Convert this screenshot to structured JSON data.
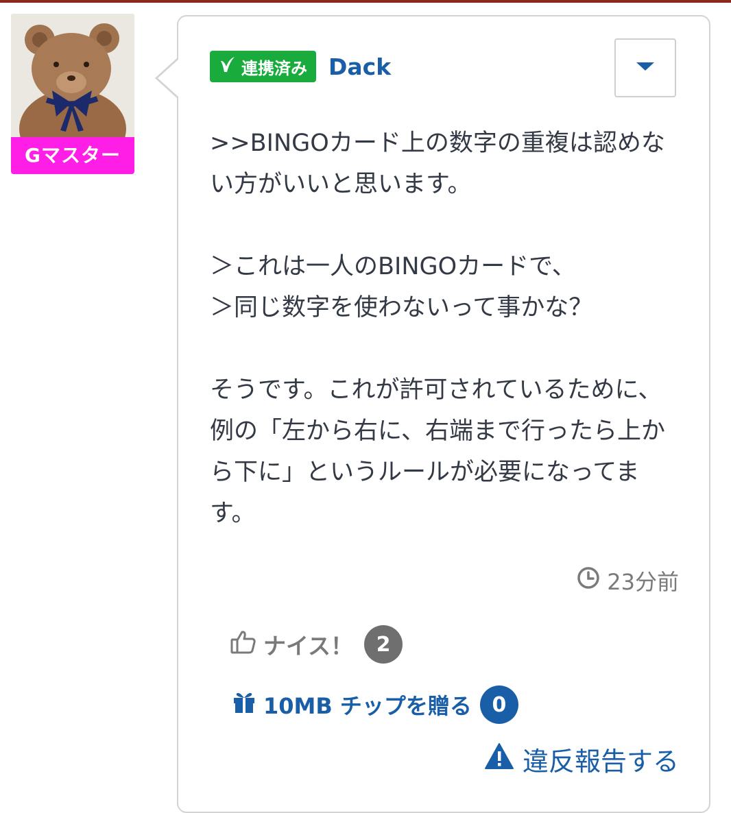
{
  "colors": {
    "rank_badge": "#ff1ee6",
    "linked_badge": "#1aab3d",
    "link_blue": "#1a5ea8",
    "count_gray": "#6f6f6f",
    "top_bar": "#8a2a1c"
  },
  "user": {
    "avatar_icon": "teddy-bear-avatar",
    "rank": "Gマスター",
    "linked_label": "連携済み",
    "name": "Dack"
  },
  "post": {
    "body": ">>BINGOカード上の数字の重複は認めない方がいいと思います。\n\n＞これは一人のBINGOカードで、\n＞同じ数字を使わないって事かな？\n\nそうです。これが許可されているために、例の「左から右に、右端まで行ったら上から下に」というルールが必要になってます。",
    "time": "23分前"
  },
  "actions": {
    "nice_label": "ナイス！",
    "nice_count": "2",
    "tip_label": "10MB チップを贈る",
    "tip_count": "0",
    "report_label": "違反報告する"
  }
}
